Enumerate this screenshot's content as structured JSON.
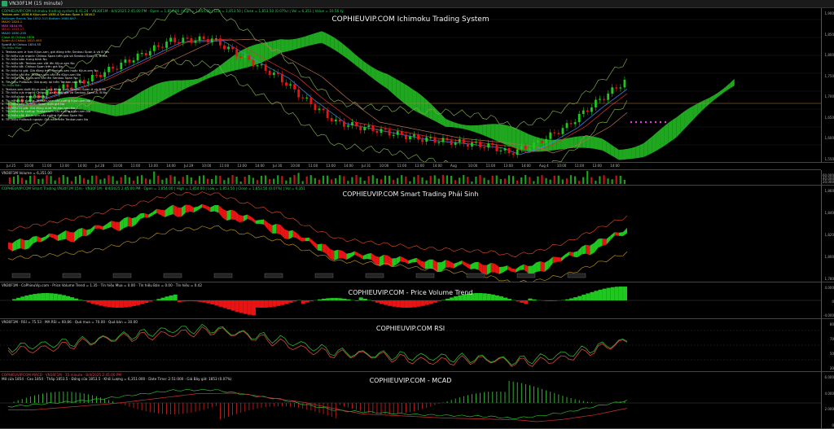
{
  "window": {
    "title": "VN30F1M (15 minute)"
  },
  "pane1": {
    "title": "COPHIEUVIP.COM Ichimoku Trading System",
    "header": "COPHIEUVIP.COM Ichimoku trading system 8.41.24 · VN30F1M · 8/4/2025 2:45:00 PM · Open = 1,854.00 | High = 1,854.00 | Low = 1,853.50 | Close = 1,853.50 (0.07%) | Vol = 6,351 | Value = 10.56 tỷ",
    "legend": [
      "Tenkan-sen: 1836.6  Kijun-sen  1838.4  Senkou Span A  1816.2",
      "Bollinger Bands Top  1852.313  Bottom  1686.887",
      "MA20  1824.1",
      "MA5  1844.95",
      "MA10  1833.17",
      "MA20  1830.235",
      "Close Al Chikou  1806",
      "Spam Al Chikou  1813.463",
      "SpanB Al Chikou  1834.35",
      "Tín hiệu Mua",
      "1. Tenkan-sen ≥ hơn Kijun-sen, giá đóng trên Senkou Span A và B  Yes",
      "2. Tín hiệu cực mạnh: Chikou Span trên giá và Senkou Span A, B  Yes",
      "3. Tín hiệu bán trung bình  No",
      "4. Tín hiệu tốt: Tenkan-sen cắt lên Kijun-sen  No",
      "5. Tín hiệu tốt: Chikou Span trên giá  No",
      "6. Tín hiệu từ giá: Giá đóng trên Tenkan-sen hoặc Kijun-sen  No",
      "7. Tín hiệu cắt lên: Tenkan-sen cắt lên Kijun-sen  No",
      "8. Tín hiệu cắt: Kijun-sen cắt lên Senkou Span  No",
      "9. Tín hiệu Pullback: Giá quay lại trên Tenkan-sen  No",
      "Tín hiệu Bán",
      "1. Tenkan-sen dưới Kijun-sen, giá đóng dưới Senkou Span A và B  No",
      "2. Tín hiệu cực mạnh: Chikou Span dưới giá và Senkou Span A, B  No",
      "3. Tín hiệu bán trung bình  No",
      "4. Tín hiệu cắt xuống: Tenkan-sen cắt xuống Kijun-sen  No",
      "5. Tín hiệu xấu: Chikou Span dưới giá  No",
      "6. Tín hiệu từ giá: Giá đóng dưới Tenkan-sen  No",
      "7. Tín hiệu cắt xuống: Tenkan-sen cắt xuống Kijun-sen  No",
      "8. Tín hiệu cắt: Kijun-sen cắt xuống Senkou Span  No",
      "9. Tín hiệu Pullback ngược: Giá nằm trên Tenkan-sen  No"
    ],
    "price_ticks": [
      "1,900",
      "1,850",
      "1,800",
      "1,750",
      "1,700",
      "1,650",
      "1,600",
      "1,550"
    ],
    "dates": [
      "Jul 25",
      "10:00",
      "11:00",
      "13:00",
      "14:00",
      "Jul 28",
      "10:00",
      "11:00",
      "13:00",
      "14:00",
      "Jul 29",
      "10:00",
      "11:00",
      "13:00",
      "14:00",
      "Jul 30",
      "10:00",
      "11:00",
      "13:00",
      "14:00",
      "Jul 31",
      "10:00",
      "11:00",
      "13:00",
      "14:00",
      "Aug",
      "10:00",
      "11:00",
      "13:00",
      "14:00",
      "Aug 4",
      "10:00",
      "11:00",
      "13:00",
      "14:00"
    ]
  },
  "volume": {
    "header": "VN30F1M  Volume = 6,351.00",
    "ticks": [
      "60,000",
      "40,000",
      "20,000"
    ]
  },
  "pane2": {
    "title": "COPHIEUVIP.COM Smart Trading Phái Sinh",
    "header": "COPHIEUVIP.COM Smart Trading VN30F1M 15m · VN30F1M · 8/4/2025 2:45:00 PM · Open = 1,854.00 | High = 1,854.00 | Low = 1,853.50 | Close = 1,853.50 (0.07%) | Vol = 6,351",
    "ticks": [
      "1,860",
      "1,840",
      "1,820",
      "1,800",
      "1,780"
    ]
  },
  "pane3": {
    "title": "COPHIEUVIP.COM - Price Volume Trend",
    "header": "VN30F1M - CoPhieuVip.com - Price Volume Trend = 1.35 · Tín hiệu Mua = 0.00 · Tín hiệu Bán = 0.00 · Tín hiệu = 0.42",
    "ticks": [
      "4.000",
      "0",
      "-4.000"
    ]
  },
  "pane4": {
    "title": "COPHIEUVIP.COM RSI",
    "header": "VN30F1M · RSI = 75.53 · MA RSI = 60.86 · Quá mua = 70.00 · Quá bán = 30.00",
    "ticks": [
      "80",
      "70",
      "50",
      "30"
    ]
  },
  "pane5": {
    "title": "COPHIEUVIP.COM - MCAD",
    "header1": "COPHIEUVIP.COM MACD · VN30F1M · 15 minute · 8/4/2025 2:45:00 PM",
    "header2": "Mở cửa 1854 · Cao 1854 · Thấp 1853.5 · Đóng cửa 1853.5 · Khối Lượng = 6,351.000 · Date Time: 2:51:000 · Giá Bây giờ: 1853 (0.07%)",
    "ticks": [
      "6.000",
      "4.000",
      "2.000",
      "0"
    ]
  },
  "colors": {
    "up": "#1ec81e",
    "down": "#e81414",
    "cloud_up": "#22b022",
    "cloud_down": "#ffb400",
    "bg": "#000000"
  },
  "icons": {
    "app": "chart-icon"
  }
}
